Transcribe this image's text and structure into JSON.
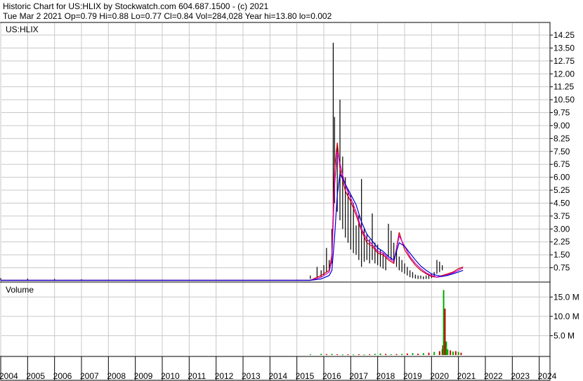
{
  "header": {
    "line1": "Historic Chart for US:HLIX by Stockwatch.com 604.687.1500 - (c) 2021",
    "line2": "Tue Mar  2 2021   Op=0.79  Hi=0.88  Lo=0.77  Cl=0.84  Vol=284,028  Year hi=13.80  lo=0.002"
  },
  "colors": {
    "price": "#000000",
    "ma_short": "#cc0000",
    "ma_mid": "#cc00cc",
    "ma_long": "#0000cc",
    "vol_up": "#00aa00",
    "vol_down": "#cc0000",
    "grid": "#c8c8c8"
  },
  "chart_data": [
    {
      "type": "line",
      "panel": "price",
      "title": "US:HLIX",
      "xlabel": "",
      "ylabel": "",
      "grid": true,
      "ylim": [
        0,
        14.25
      ],
      "y_ticks": [
        "14.25",
        "13.50",
        "12.75",
        "12.00",
        "11.25",
        "10.50",
        "9.75",
        "9.00",
        "8.25",
        "7.50",
        "6.75",
        "6.00",
        "5.25",
        "4.50",
        "3.75",
        "3.00",
        "2.25",
        "1.50",
        "0.75"
      ],
      "x_ticks": [
        "2004",
        "2005",
        "2006",
        "2007",
        "2008",
        "2009",
        "2010",
        "2011",
        "2012",
        "2013",
        "2014",
        "2015",
        "2016",
        "2017",
        "2018",
        "2019",
        "2020",
        "2021",
        "2022",
        "2023",
        "2024"
      ],
      "series": [
        {
          "role": "price_range",
          "x": [
            2004.0,
            2005.0,
            2006.0,
            2007.0,
            2008.0,
            2009.0,
            2010.0,
            2011.0,
            2012.0,
            2013.0,
            2014.0,
            2015.0,
            2015.5,
            2015.75,
            2015.9,
            2016.0,
            2016.1,
            2016.2,
            2016.3,
            2016.35,
            2016.4,
            2016.5,
            2016.6,
            2016.7,
            2016.8,
            2016.9,
            2017.0,
            2017.1,
            2017.2,
            2017.3,
            2017.4,
            2017.5,
            2017.6,
            2017.7,
            2017.8,
            2017.9,
            2018.0,
            2018.1,
            2018.2,
            2018.3,
            2018.4,
            2018.5,
            2018.6,
            2018.7,
            2018.8,
            2018.9,
            2019.0,
            2019.1,
            2019.2,
            2019.3,
            2019.4,
            2019.5,
            2019.6,
            2019.7,
            2019.8,
            2019.9,
            2020.0,
            2020.1,
            2020.2,
            2020.3,
            2020.4,
            2020.5,
            2020.6,
            2020.7,
            2020.8,
            2020.9,
            2021.0,
            2021.1,
            2021.17
          ],
          "high": [
            0.15,
            0.12,
            0.1,
            0.08,
            0.06,
            0.05,
            0.05,
            0.04,
            0.04,
            0.04,
            0.04,
            0.05,
            0.3,
            0.8,
            0.6,
            0.9,
            1.9,
            1.2,
            3.0,
            13.8,
            9.5,
            8.0,
            10.5,
            7.2,
            6.0,
            5.3,
            5.0,
            4.5,
            3.2,
            3.8,
            5.9,
            3.0,
            2.7,
            2.4,
            3.9,
            2.2,
            2.1,
            1.8,
            1.6,
            1.4,
            3.3,
            2.9,
            2.2,
            1.8,
            1.4,
            1.2,
            1.0,
            0.8,
            0.6,
            0.5,
            0.35,
            0.3,
            0.3,
            0.25,
            0.3,
            0.35,
            0.4,
            0.5,
            1.2,
            1.1,
            0.9
          ],
          "low": [
            0.001,
            0.001,
            0.002,
            0.002,
            0.002,
            0.002,
            0.002,
            0.002,
            0.002,
            0.002,
            0.002,
            0.002,
            0.1,
            0.2,
            0.2,
            0.3,
            0.5,
            0.6,
            1.0,
            4.0,
            4.5,
            4.0,
            3.5,
            3.0,
            2.5,
            2.2,
            1.8,
            1.6,
            1.5,
            1.2,
            0.8,
            1.1,
            1.2,
            1.0,
            1.2,
            1.0,
            0.9,
            0.8,
            0.7,
            0.6,
            1.4,
            1.2,
            1.0,
            0.8,
            0.6,
            0.5,
            0.4,
            0.3,
            0.2,
            0.15,
            0.12,
            0.1,
            0.1,
            0.08,
            0.1,
            0.1,
            0.15,
            0.2,
            0.4,
            0.5,
            0.6
          ]
        },
        {
          "role": "moving_average_short",
          "x": [
            2004.0,
            2015.5,
            2015.9,
            2016.2,
            2016.3,
            2016.4,
            2016.5,
            2016.6,
            2016.8,
            2017.0,
            2017.2,
            2017.4,
            2017.6,
            2017.8,
            2018.0,
            2018.2,
            2018.4,
            2018.6,
            2018.8,
            2019.0,
            2019.2,
            2019.4,
            2019.6,
            2019.8,
            2020.0,
            2020.2,
            2020.4,
            2020.6,
            2020.8,
            2021.0,
            2021.17
          ],
          "y": [
            0.02,
            0.02,
            0.3,
            0.6,
            1.5,
            6.5,
            8.0,
            6.5,
            5.2,
            4.6,
            3.8,
            2.9,
            2.2,
            2.0,
            1.6,
            1.5,
            1.2,
            1.0,
            2.8,
            1.8,
            1.3,
            0.9,
            0.6,
            0.4,
            0.25,
            0.2,
            0.3,
            0.4,
            0.5,
            0.7,
            0.8
          ]
        },
        {
          "role": "moving_average_mid",
          "x": [
            2004.0,
            2015.5,
            2015.9,
            2016.2,
            2016.3,
            2016.4,
            2016.5,
            2016.6,
            2016.8,
            2017.0,
            2017.2,
            2017.4,
            2017.6,
            2017.8,
            2018.0,
            2018.2,
            2018.4,
            2018.6,
            2018.8,
            2019.0,
            2019.2,
            2019.4,
            2019.6,
            2019.8,
            2020.0,
            2020.2,
            2020.4,
            2020.6,
            2020.8,
            2021.0,
            2021.17
          ],
          "y": [
            0.02,
            0.02,
            0.2,
            0.5,
            1.2,
            5.5,
            7.5,
            6.8,
            5.5,
            4.8,
            4.0,
            3.0,
            2.4,
            2.1,
            1.7,
            1.6,
            1.3,
            1.1,
            2.6,
            2.0,
            1.4,
            1.0,
            0.7,
            0.45,
            0.3,
            0.2,
            0.25,
            0.35,
            0.45,
            0.6,
            0.75
          ]
        },
        {
          "role": "moving_average_long",
          "x": [
            2004.0,
            2015.5,
            2015.9,
            2016.2,
            2016.3,
            2016.4,
            2016.5,
            2016.6,
            2016.8,
            2017.0,
            2017.2,
            2017.4,
            2017.6,
            2017.8,
            2018.0,
            2018.2,
            2018.4,
            2018.6,
            2018.8,
            2019.0,
            2019.2,
            2019.4,
            2019.6,
            2019.8,
            2020.0,
            2020.2,
            2020.4,
            2020.6,
            2020.8,
            2021.0,
            2021.17
          ],
          "y": [
            0.02,
            0.02,
            0.1,
            0.3,
            0.6,
            2.5,
            5.0,
            6.2,
            5.6,
            5.0,
            4.4,
            3.4,
            2.7,
            2.3,
            1.9,
            1.7,
            1.4,
            1.2,
            2.2,
            2.0,
            1.6,
            1.2,
            0.85,
            0.6,
            0.4,
            0.3,
            0.25,
            0.3,
            0.4,
            0.5,
            0.6
          ]
        }
      ]
    },
    {
      "type": "bar",
      "panel": "volume",
      "title": "Volume",
      "grid": true,
      "ylim": [
        0,
        18.5
      ],
      "y_ticks": [
        "15.0 M",
        "10.0 M",
        "5.0 M"
      ],
      "series": [
        {
          "name": "Volume",
          "x": [
            2015.5,
            2015.9,
            2016.1,
            2016.3,
            2016.5,
            2016.7,
            2016.9,
            2017.1,
            2017.3,
            2017.5,
            2017.7,
            2017.9,
            2018.1,
            2018.3,
            2018.5,
            2018.7,
            2018.9,
            2019.1,
            2019.3,
            2019.5,
            2019.7,
            2019.9,
            2020.1,
            2020.3,
            2020.4,
            2020.42,
            2020.45,
            2020.5,
            2020.55,
            2020.6,
            2020.7,
            2020.8,
            2020.9,
            2021.0,
            2021.1
          ],
          "values": [
            0.2,
            0.3,
            0.25,
            0.3,
            0.2,
            0.15,
            0.2,
            0.15,
            0.2,
            0.15,
            0.2,
            0.3,
            0.4,
            0.3,
            0.2,
            0.25,
            0.3,
            0.4,
            0.5,
            0.35,
            0.5,
            0.6,
            0.8,
            1.0,
            1.5,
            2.5,
            16.8,
            12.0,
            3.5,
            1.5,
            1.2,
            0.9,
            1.0,
            0.8,
            0.6
          ],
          "up": [
            true,
            true,
            false,
            true,
            false,
            true,
            false,
            true,
            false,
            true,
            false,
            true,
            true,
            false,
            true,
            false,
            true,
            false,
            true,
            false,
            true,
            false,
            true,
            false,
            true,
            false,
            true,
            false,
            true,
            true,
            false,
            true,
            false,
            true,
            false
          ]
        }
      ]
    }
  ]
}
